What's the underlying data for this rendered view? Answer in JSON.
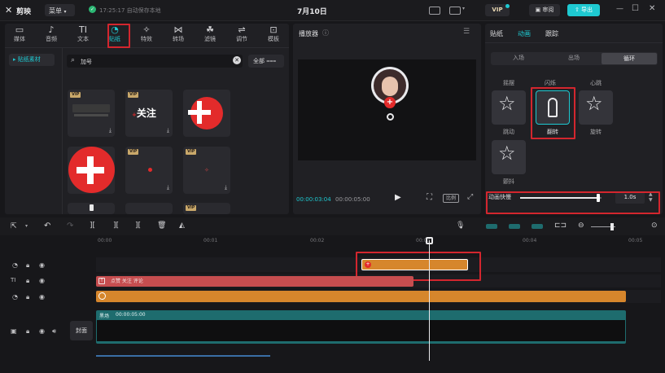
{
  "app": {
    "name": "剪映",
    "menu": "菜单",
    "autosave": "17:25:17 自动保存本地",
    "title": "7月10日",
    "vip": "VIP",
    "review": "审阅",
    "export": "导出"
  },
  "colors": {
    "accent": "#1ec9d1",
    "highlight": "#d3262e",
    "clip_orange": "#d6862c",
    "clip_red": "#c64d4f",
    "clip_teal": "#1e6c6e"
  },
  "media_tabs": [
    {
      "icon": "media-icon",
      "glyph": "▭",
      "label": "媒体"
    },
    {
      "icon": "audio-icon",
      "glyph": "♪",
      "label": "音频"
    },
    {
      "icon": "text-icon",
      "glyph": "TI",
      "label": "文本"
    },
    {
      "icon": "sticker-icon",
      "glyph": "◔",
      "label": "贴纸"
    },
    {
      "icon": "effects-icon",
      "glyph": "✧",
      "label": "特效"
    },
    {
      "icon": "transition-icon",
      "glyph": "⋈",
      "label": "转场"
    },
    {
      "icon": "filter-icon",
      "glyph": "☘",
      "label": "滤镜"
    },
    {
      "icon": "adjust-icon",
      "glyph": "⇌",
      "label": "调节"
    },
    {
      "icon": "template-icon",
      "glyph": "⊡",
      "label": "模板"
    }
  ],
  "sticker": {
    "side_label": "▸ 贴纸素材",
    "search_value": "加号",
    "filter_label": "全部",
    "vip_badge": "VIP",
    "tile1_text": "关注"
  },
  "player": {
    "title": "播放器",
    "time_current": "00:00:03:04",
    "time_total": "00:00:05:00",
    "ratio_label": "比例"
  },
  "right_panel": {
    "tabs": [
      "贴纸",
      "动画",
      "跟踪"
    ],
    "subtabs": [
      "入场",
      "出场",
      "循环"
    ],
    "animations": [
      {
        "top": "摇摆",
        "bottom": "跳动"
      },
      {
        "top": "闪烁",
        "bottom": "翻转"
      },
      {
        "top": "心跳",
        "bottom": "旋转"
      },
      {
        "top": "",
        "bottom": "颤抖"
      }
    ],
    "speed_label": "动画快慢",
    "speed_value": "1.0s",
    "speed_fraction": 0.96
  },
  "timeline": {
    "ticks": [
      "00:00",
      "00:01",
      "00:02",
      "00:03",
      "00:04",
      "00:05"
    ],
    "text_clip": "点赞 关注 评论",
    "main_clip_name": "黑场",
    "main_clip_duration": "00:00:05:00",
    "cover_label": "封面"
  }
}
